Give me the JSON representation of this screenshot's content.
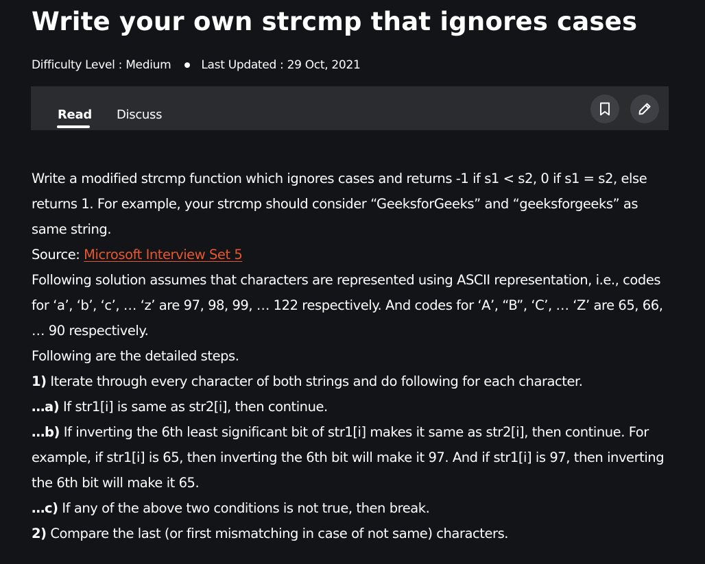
{
  "article": {
    "title": "Write your own strcmp that ignores cases",
    "difficulty": "Difficulty Level : Medium",
    "last_updated": "Last Updated : 29 Oct, 2021"
  },
  "tabs": {
    "read": "Read",
    "discuss": "Discuss"
  },
  "icons": {
    "bookmark": "bookmark-icon",
    "edit": "pencil-icon"
  },
  "colors": {
    "background": "#131417",
    "tabbar": "#2b2c30",
    "link": "#e8572f"
  },
  "body": {
    "intro_1": "Write a modified strcmp function which ignores cases and returns -1 if s1 < s2, 0 if s1 = s2, else returns 1. For example, your strcmp should consider “GeeksforGeeks” and “geeksforgeeks” as same string.",
    "source_label": "Source: ",
    "source_link": "Microsoft Interview Set 5",
    "assumption": "Following solution assumes that characters are represented using ASCII representation, i.e., codes for ‘a’, ‘b’, ‘c’, … ‘z’ are 97, 98, 99, … 122 respectively. And codes for ‘A’, “B”, ‘C’, … ‘Z’ are 65, 66, … 90 respectively.",
    "steps_intro": "Following are the detailed steps.",
    "step1_num": "1)",
    "step1_text": " Iterate through every character of both strings and do following for each character.",
    "step1a_num": "…a)",
    "step1a_text": " If str1[i] is same as str2[i], then continue.",
    "step1b_num": "…b)",
    "step1b_text": " If inverting the 6th least significant bit of str1[i] makes it same as str2[i], then continue. For example, if str1[i] is 65, then inverting the 6th bit will make it 97. And if str1[i] is 97, then inverting the 6th bit will make it 65.",
    "step1c_num": "…c)",
    "step1c_text": " If any of the above two conditions is not true, then break.",
    "step2_num": "2)",
    "step2_text": " Compare the last (or first mismatching in case of not same) characters."
  }
}
